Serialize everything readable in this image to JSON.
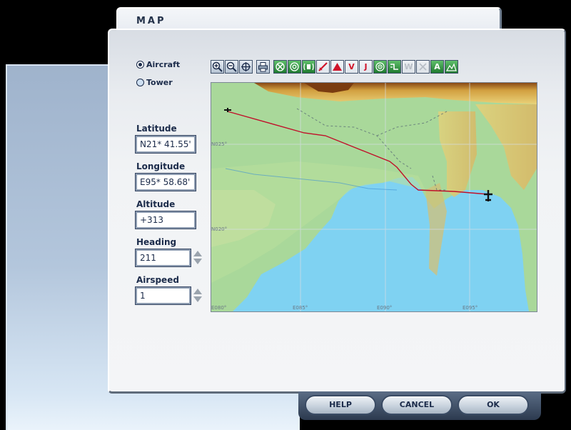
{
  "window": {
    "title": "MAP"
  },
  "view_mode": {
    "aircraft": {
      "label": "Aircraft",
      "selected": true
    },
    "tower": {
      "label": "Tower",
      "selected": false
    }
  },
  "fields": {
    "latitude": {
      "label": "Latitude",
      "value": "N21* 41.55'"
    },
    "longitude": {
      "label": "Longitude",
      "value": "E95* 58.68'"
    },
    "altitude": {
      "label": "Altitude",
      "value": "+313"
    },
    "heading": {
      "label": "Heading",
      "value": "211"
    },
    "airspeed": {
      "label": "Airspeed",
      "value": "1"
    }
  },
  "toolbar": {
    "icons": [
      "zoom-in-icon",
      "zoom-out-icon",
      "center-aircraft-icon",
      "print-icon",
      "vor-icon",
      "ndb-icon",
      "ils-icon",
      "airport-icon",
      "airways-triangle-icon",
      "victor-airways-icon",
      "jet-airways-icon",
      "radar-icon",
      "route-icon",
      "waypoint-icon",
      "disabled-waypoint-icon",
      "airspace-labels-icon",
      "terrain-icon"
    ],
    "text_glyphs": {
      "v": "V",
      "j": "J",
      "w": "W",
      "a": "A"
    }
  },
  "map": {
    "lat_labels": [
      "N025°",
      "N020°"
    ],
    "lon_labels": [
      "E080°",
      "E085°",
      "E090°",
      "E095°"
    ],
    "colors": {
      "water": "#7fd2f2",
      "land": "#a9d89a",
      "route": "#c0102a"
    }
  },
  "buttons": {
    "help": "HELP",
    "cancel": "CANCEL",
    "ok": "OK"
  }
}
